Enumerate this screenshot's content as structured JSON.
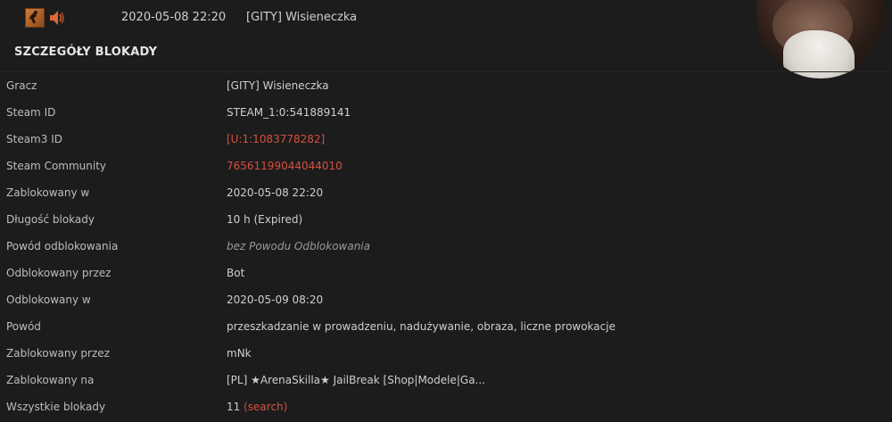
{
  "header": {
    "date": "2020-05-08 22:20",
    "player_name": "[GITY] Wisieneczka",
    "section_title": "SZCZEGÓŁY BLOKADY"
  },
  "icons": {
    "game": "counter-strike-icon",
    "mute": "speaker-muted-icon",
    "avatar": "user-avatar"
  },
  "colors": {
    "background": "#1c1c1c",
    "label": "#bdbdbd",
    "value": "#cfcfcf",
    "link": "#d6503e",
    "muted_italic": "#9a9a9a"
  },
  "details": [
    {
      "label": "Gracz",
      "value": "[GITY] Wisieneczka"
    },
    {
      "label": "Steam ID",
      "value": "STEAM_1:0:541889141"
    },
    {
      "label": "Steam3 ID",
      "value": "[U:1:1083778282]"
    },
    {
      "label": "Steam Community",
      "value": "76561199044044010"
    },
    {
      "label": "Zablokowany w",
      "value": "2020-05-08 22:20"
    },
    {
      "label": "Długość blokady",
      "value": "10 h (Expired)"
    },
    {
      "label": "Powód odblokowania",
      "value": "bez Powodu Odblokowania"
    },
    {
      "label": "Odblokowany przez",
      "value": "Bot"
    },
    {
      "label": "Odblokowany w",
      "value": "2020-05-09 08:20"
    },
    {
      "label": "Powód",
      "value": "przeszkadzanie w prowadzeniu, nadużywanie, obraza, liczne prowokacje"
    },
    {
      "label": "Zablokowany przez",
      "value": "mNk"
    },
    {
      "label": "Zablokowany na",
      "value": "[PL] ★ArenaSkilla★ JailBreak [Shop|Modele|Ga..."
    },
    {
      "label": "Wszystkie blokady",
      "value": "11",
      "link": "(search)"
    }
  ]
}
